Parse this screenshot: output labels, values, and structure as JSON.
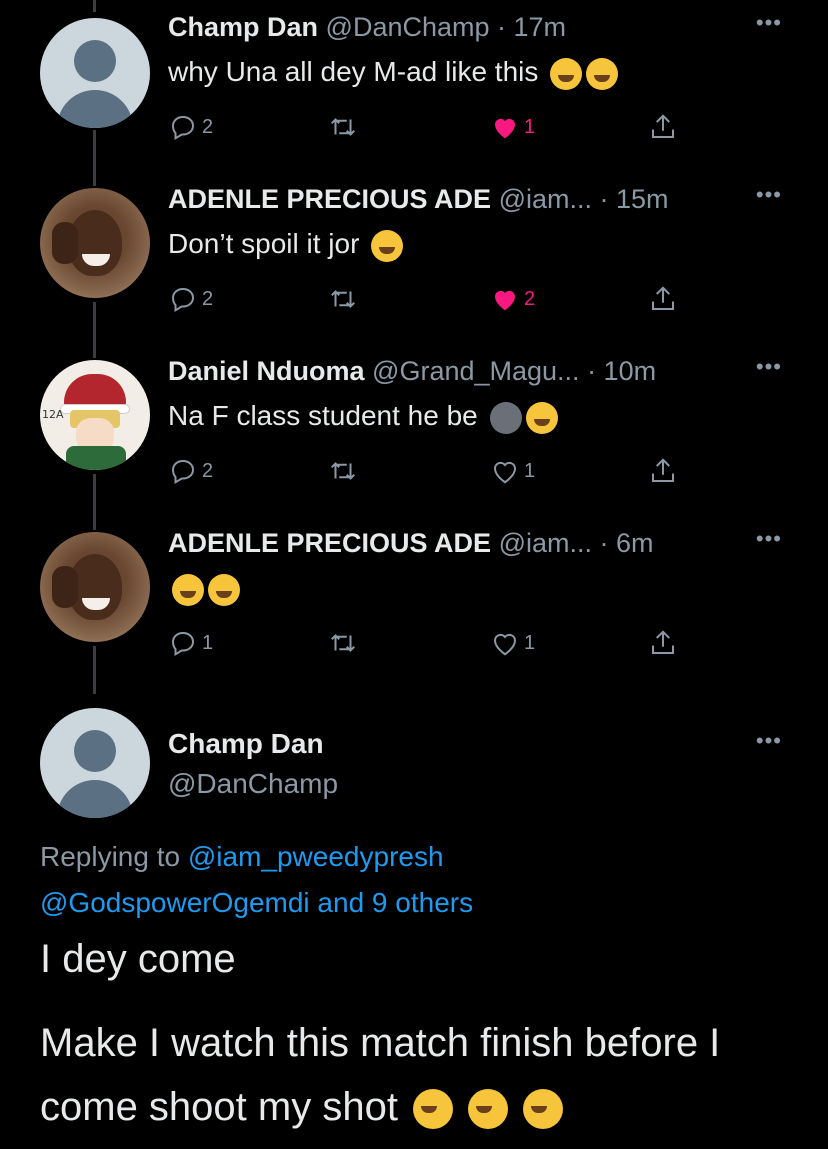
{
  "replies": [
    {
      "name": "Champ Dan",
      "handle": "@DanChamp",
      "time": " · 17m",
      "text": "why Una all dey M-ad like this",
      "emojis": [
        "joy",
        "joy"
      ],
      "reply_count": "2",
      "like_count": "1",
      "liked": true,
      "avatar": "default-avatar"
    },
    {
      "name": "ADENLE  PRECIOUS ADE",
      "handle": "@iam...",
      "time": " · 15m",
      "text": "Don’t spoil it jor",
      "emojis": [
        "joy"
      ],
      "reply_count": "2",
      "like_count": "2",
      "liked": true,
      "avatar": "photo-avatar"
    },
    {
      "name": "Daniel Nduoma",
      "handle": "@Grand_Magu...",
      "time": " · 10m",
      "text": "Na F class student he be",
      "emojis": [
        "new-moon-face",
        "joy"
      ],
      "reply_count": "2",
      "like_count": "1",
      "liked": false,
      "avatar": "anime-avatar"
    },
    {
      "name": "ADENLE  PRECIOUS ADE",
      "handle": "@iam...",
      "time": " · 6m",
      "text": "",
      "emojis": [
        "joy",
        "rofl"
      ],
      "reply_count": "1",
      "like_count": "1",
      "liked": false,
      "avatar": "photo-avatar"
    }
  ],
  "main_tweet": {
    "name": "Champ Dan",
    "handle": "@DanChamp",
    "replying_prefix": "Replying to ",
    "replying_user": "@iam_pweedypresh",
    "replying_user2": "@GodspowerOgemdi",
    "replying_others": " and 9 others",
    "line1": "I dey come",
    "line2": "Make I watch  this match finish before I",
    "line3": "come shoot my shot",
    "emojis": [
      "grinning",
      "grinning",
      "grinning"
    ]
  },
  "more_label": "•••",
  "avatar_tag": "12A",
  "colors": {
    "background": "#000000",
    "text": "#e7e9ea",
    "secondary": "#8b98a5",
    "link": "#1d9bf0",
    "like": "#f91880"
  }
}
